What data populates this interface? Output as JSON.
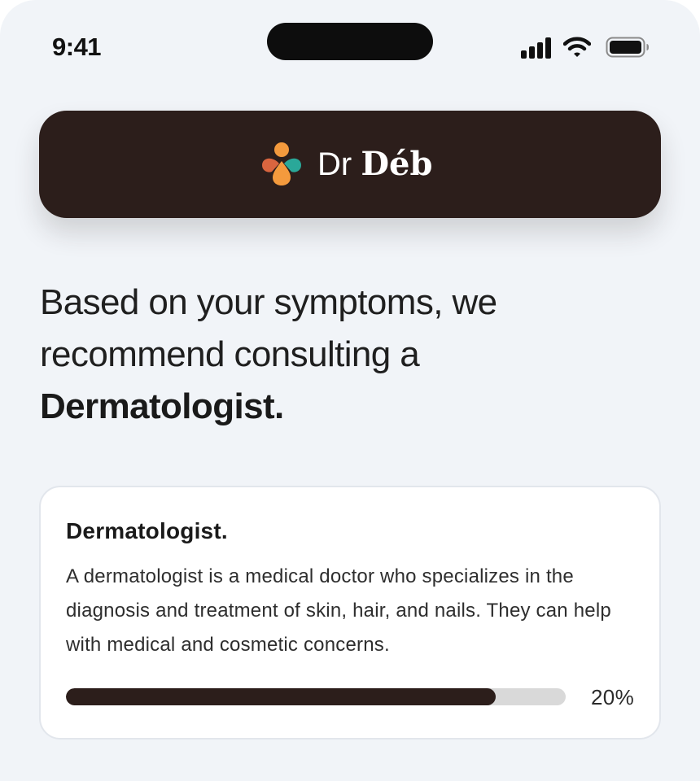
{
  "status_bar": {
    "time": "9:41",
    "icons": [
      "cellular-signal-icon",
      "wifi-icon",
      "battery-icon"
    ]
  },
  "brand": {
    "name_regular": "Dr ",
    "name_bold": "Déb",
    "logo_icon": "people-logo-icon",
    "logo_colors": {
      "orange": "#f49a3d",
      "red": "#d9653f",
      "teal": "#2aa899"
    },
    "banner_color": "#2c1e1b"
  },
  "recommendation": {
    "text_before": "Based on your symptoms, we recommend consulting a ",
    "specialist": "Dermatologist."
  },
  "specialist_card": {
    "title": "Dermatologist.",
    "description": "A dermatologist is a medical doctor who specializes in the diagnosis and treatment of skin, hair, and nails. They can help with medical and cosmetic concerns.",
    "progress_label": "20%",
    "progress_fill_percent": 86
  }
}
